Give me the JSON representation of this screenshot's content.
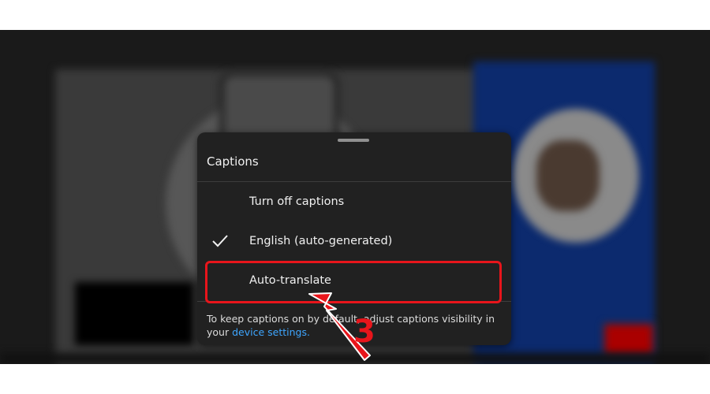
{
  "sheet": {
    "title": "Captions",
    "options": [
      {
        "label": "Turn off captions",
        "selected": false
      },
      {
        "label": "English (auto-generated)",
        "selected": true
      },
      {
        "label": "Auto-translate",
        "selected": false
      }
    ],
    "footer_text": "To keep captions on by default, adjust captions visibility in your ",
    "footer_link": "device settings."
  },
  "annotation": {
    "step_number": "3",
    "color": "#e8151b"
  },
  "colors": {
    "sheet_background": "#212121",
    "link": "#3ea6ff",
    "text": "#f1f1f1"
  },
  "icons": {
    "selected_mark": "check-icon"
  }
}
